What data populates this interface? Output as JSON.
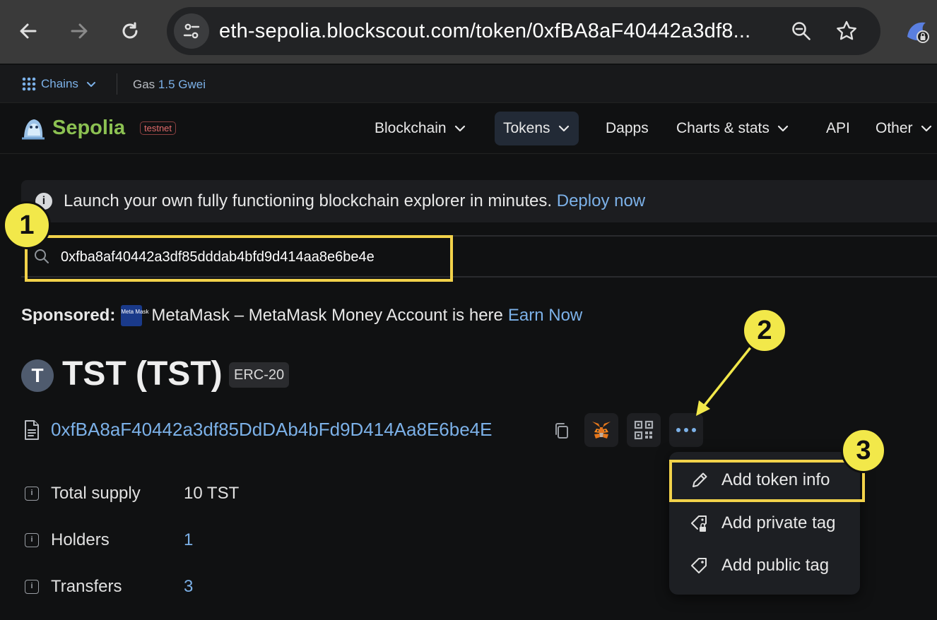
{
  "browser": {
    "url": "eth-sepolia.blockscout.com/token/0xfBA8aF40442a3df8..."
  },
  "topbar": {
    "chains_label": "Chains",
    "gas_label": "Gas",
    "gas_value": "1.5 Gwei"
  },
  "header": {
    "logo_text": "Sepolia",
    "badge": "testnet",
    "nav": [
      "Blockchain",
      "Tokens",
      "Dapps",
      "Charts & stats",
      "API",
      "Other"
    ]
  },
  "banner": {
    "text": "Launch your own fully functioning blockchain explorer in minutes.",
    "link": "Deploy now"
  },
  "search": {
    "value": "0xfba8af40442a3df85dddab4bfd9d414aa8e6be4e"
  },
  "sponsored": {
    "label": "Sponsored:",
    "logo_text": "Meta Mask",
    "text": "MetaMask – MetaMask Money Account is here",
    "link": "Earn Now"
  },
  "token": {
    "avatar_letter": "T",
    "title": "TST (TST)",
    "standard": "ERC-20",
    "address": "0xfBA8aF40442a3df85DdDAb4bFd9D414Aa8E6be4E"
  },
  "menu": {
    "items": [
      "Add token info",
      "Add private tag",
      "Add public tag"
    ]
  },
  "stats": [
    {
      "label": "Total supply",
      "value": "10 TST"
    },
    {
      "label": "Holders",
      "value": "1"
    },
    {
      "label": "Transfers",
      "value": "3"
    }
  ],
  "callouts": [
    "1",
    "2",
    "3"
  ],
  "colors": {
    "accent_link": "#7cb1e8",
    "highlight": "#f2d24a",
    "logo_green": "#8cc152"
  }
}
